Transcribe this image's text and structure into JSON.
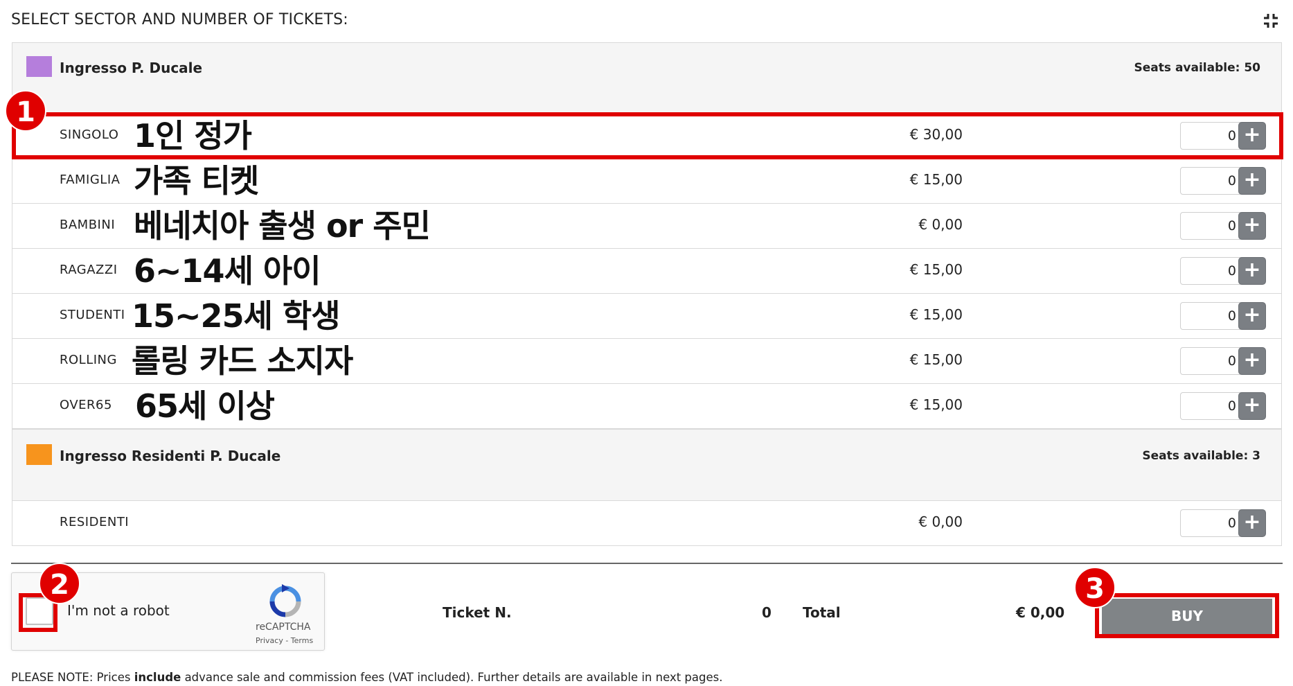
{
  "heading": "SELECT SECTOR AND NUMBER OF TICKETS:",
  "sectors": [
    {
      "name": "Ingresso P. Ducale",
      "seats": "Seats available: 50",
      "color": "#b57edc",
      "rows": [
        {
          "code": "SINGOLO",
          "note": "1인 정가",
          "price": "€ 30,00",
          "qty": "0"
        },
        {
          "code": "FAMIGLIA",
          "note": "가족 티켓",
          "price": "€ 15,00",
          "qty": "0"
        },
        {
          "code": "BAMBINI",
          "note": "베네치아 출생 or 주민",
          "price": "€ 0,00",
          "qty": "0"
        },
        {
          "code": "RAGAZZI",
          "note": "6~14세 아이",
          "price": "€ 15,00",
          "qty": "0"
        },
        {
          "code": "STUDENTI",
          "note": "15~25세 학생",
          "price": "€ 15,00",
          "qty": "0"
        },
        {
          "code": "ROLLING",
          "note": "롤링 카드 소지자",
          "price": "€ 15,00",
          "qty": "0"
        },
        {
          "code": "OVER65",
          "note": "65세 이상",
          "price": "€ 15,00",
          "qty": "0"
        }
      ]
    },
    {
      "name": "Ingresso Residenti P. Ducale",
      "seats": "Seats available: 3",
      "color": "#f7941d",
      "rows": [
        {
          "code": "RESIDENTI",
          "price": "€ 0,00",
          "qty": "0"
        }
      ]
    }
  ],
  "plus_symbol": "+",
  "badges": [
    "1",
    "2",
    "3"
  ],
  "captcha": {
    "label": "I'm not a robot",
    "brand": "reCAPTCHA",
    "privacy": "Privacy",
    "sep": " - ",
    "terms": "Terms"
  },
  "footer": {
    "ticket_label": "Ticket N.",
    "ticket_count": "0",
    "total_label": "Total",
    "total_value": "€ 0,00",
    "buy_label": "BUY"
  },
  "note": {
    "prefix": "PLEASE NOTE: Prices ",
    "emphasis": "include",
    "suffix": " advance sale and commission fees (VAT included). Further details are available in next pages."
  },
  "colors": {
    "highlight": "#e00000",
    "buy_bg": "#808487",
    "plus_bg": "#7b7f84"
  }
}
